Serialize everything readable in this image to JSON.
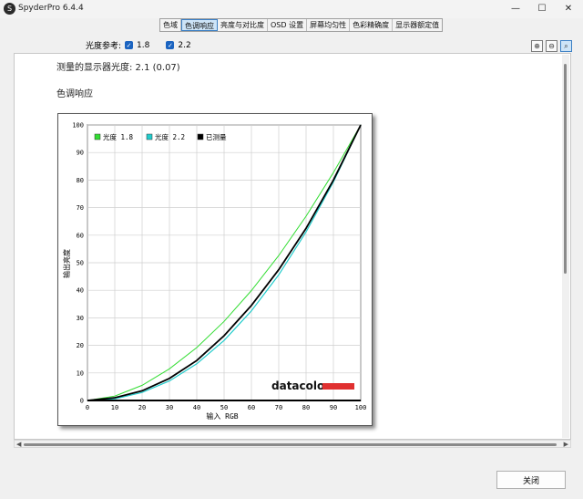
{
  "window": {
    "title": "SpyderPro 6.4.4",
    "minimize": "—",
    "maximize": "☐",
    "close": "✕"
  },
  "tabs": [
    {
      "label": "色域"
    },
    {
      "label": "色调响应",
      "active": true
    },
    {
      "label": "亮度与对比度"
    },
    {
      "label": "OSD 设置"
    },
    {
      "label": "屏幕均匀性"
    },
    {
      "label": "色彩精确度"
    },
    {
      "label": "显示器额定值"
    }
  ],
  "gamma_ref": {
    "label": "光度参考:",
    "opt1": "1.8",
    "opt2": "2.2",
    "check": "✓"
  },
  "measured_text": "测量的显示器光度: 2.1 (0.07)",
  "section_title": "色调响应",
  "logo": "datacolor",
  "bottom_button": "关闭",
  "colors": {
    "gamma18": "#33dd33",
    "gamma22": "#22cccc",
    "measured": "#000000",
    "logo_bar": "#e03030",
    "accent": "#1a63c0"
  },
  "chart_data": {
    "type": "line",
    "xlabel": "输入 RGB",
    "ylabel": "输出亮度",
    "xlim": [
      0,
      100
    ],
    "ylim": [
      0,
      100
    ],
    "xticks": [
      0,
      10,
      20,
      30,
      40,
      50,
      60,
      70,
      80,
      90,
      100
    ],
    "yticks": [
      0,
      10,
      20,
      30,
      40,
      50,
      60,
      70,
      80,
      90,
      100
    ],
    "grid": true,
    "legend": "top-left",
    "series": [
      {
        "name": "光度 1.8",
        "x": [
          0,
          10,
          20,
          30,
          40,
          50,
          60,
          70,
          80,
          90,
          100
        ],
        "y": [
          0,
          1.6,
          5.5,
          11.5,
          19.2,
          28.7,
          39.9,
          52.6,
          66.9,
          82.7,
          100
        ]
      },
      {
        "name": "光度 2.2",
        "x": [
          0,
          10,
          20,
          30,
          40,
          50,
          60,
          70,
          80,
          90,
          100
        ],
        "y": [
          0,
          0.6,
          2.9,
          7.1,
          13.3,
          21.8,
          32.5,
          45.6,
          61.2,
          79.3,
          100
        ]
      },
      {
        "name": "已测量",
        "x": [
          0,
          10,
          20,
          30,
          40,
          50,
          60,
          70,
          80,
          90,
          100
        ],
        "y": [
          0,
          1.0,
          3.5,
          8.0,
          14.5,
          23.5,
          34.5,
          47.5,
          62.5,
          80,
          100
        ]
      }
    ]
  }
}
